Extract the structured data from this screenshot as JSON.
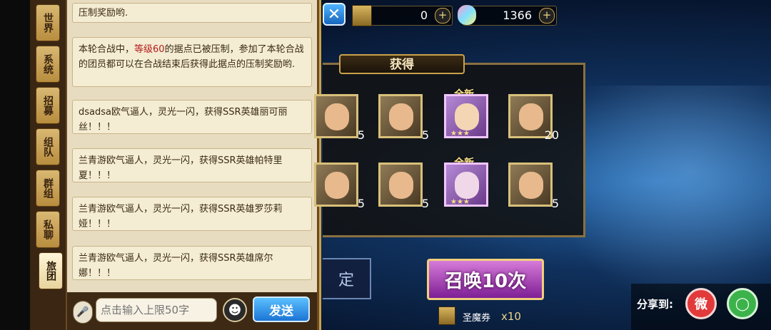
{
  "chat": {
    "tabs": [
      {
        "label": "世界"
      },
      {
        "label": "系统"
      },
      {
        "label": "招募"
      },
      {
        "label": "组队"
      },
      {
        "label": "群组"
      },
      {
        "label": "私聊"
      },
      {
        "label": "旅团"
      }
    ],
    "messages": [
      {
        "text": "压制奖励哟."
      },
      {
        "pre": "本轮合战中，",
        "highlight": "等级60",
        "post": "的据点已被压制，参加了本轮合战的团员都可以在合战结束后获得此据点的压制奖励哟."
      },
      {
        "text": "dsadsa欧气逼人，灵光一闪，获得SSR英雄丽可丽丝！！！"
      },
      {
        "text": "兰青游欧气逼人，灵光一闪，获得SSR英雄帕特里夏！！！"
      },
      {
        "text": "兰青游欧气逼人，灵光一闪，获得SSR英雄罗莎莉娅！！！"
      },
      {
        "text": "兰青游欧气逼人，灵光一闪，获得SSR英雄席尔娜！！！"
      }
    ],
    "input": {
      "placeholder": "点击输入上限50字"
    },
    "send_label": "发送"
  },
  "currency": {
    "ticket_value": "0",
    "gem_value": "1366"
  },
  "obtained": {
    "title": "获得",
    "new_label": "全新",
    "heroes": [
      {
        "count": "5",
        "new": false
      },
      {
        "count": "5",
        "new": false
      },
      {
        "count": "",
        "new": true,
        "stars": "★★★"
      },
      {
        "count": "20",
        "new": false
      },
      {
        "count": "5",
        "new": false
      },
      {
        "count": "5",
        "new": false
      },
      {
        "count": "",
        "new": true,
        "stars": "★★★"
      },
      {
        "count": "5",
        "new": false
      }
    ]
  },
  "actions": {
    "confirm_label": "定",
    "summon_label": "召唤10次",
    "ticket_name": "圣魔券",
    "ticket_count": "x10"
  },
  "share": {
    "label": "分享到:"
  }
}
